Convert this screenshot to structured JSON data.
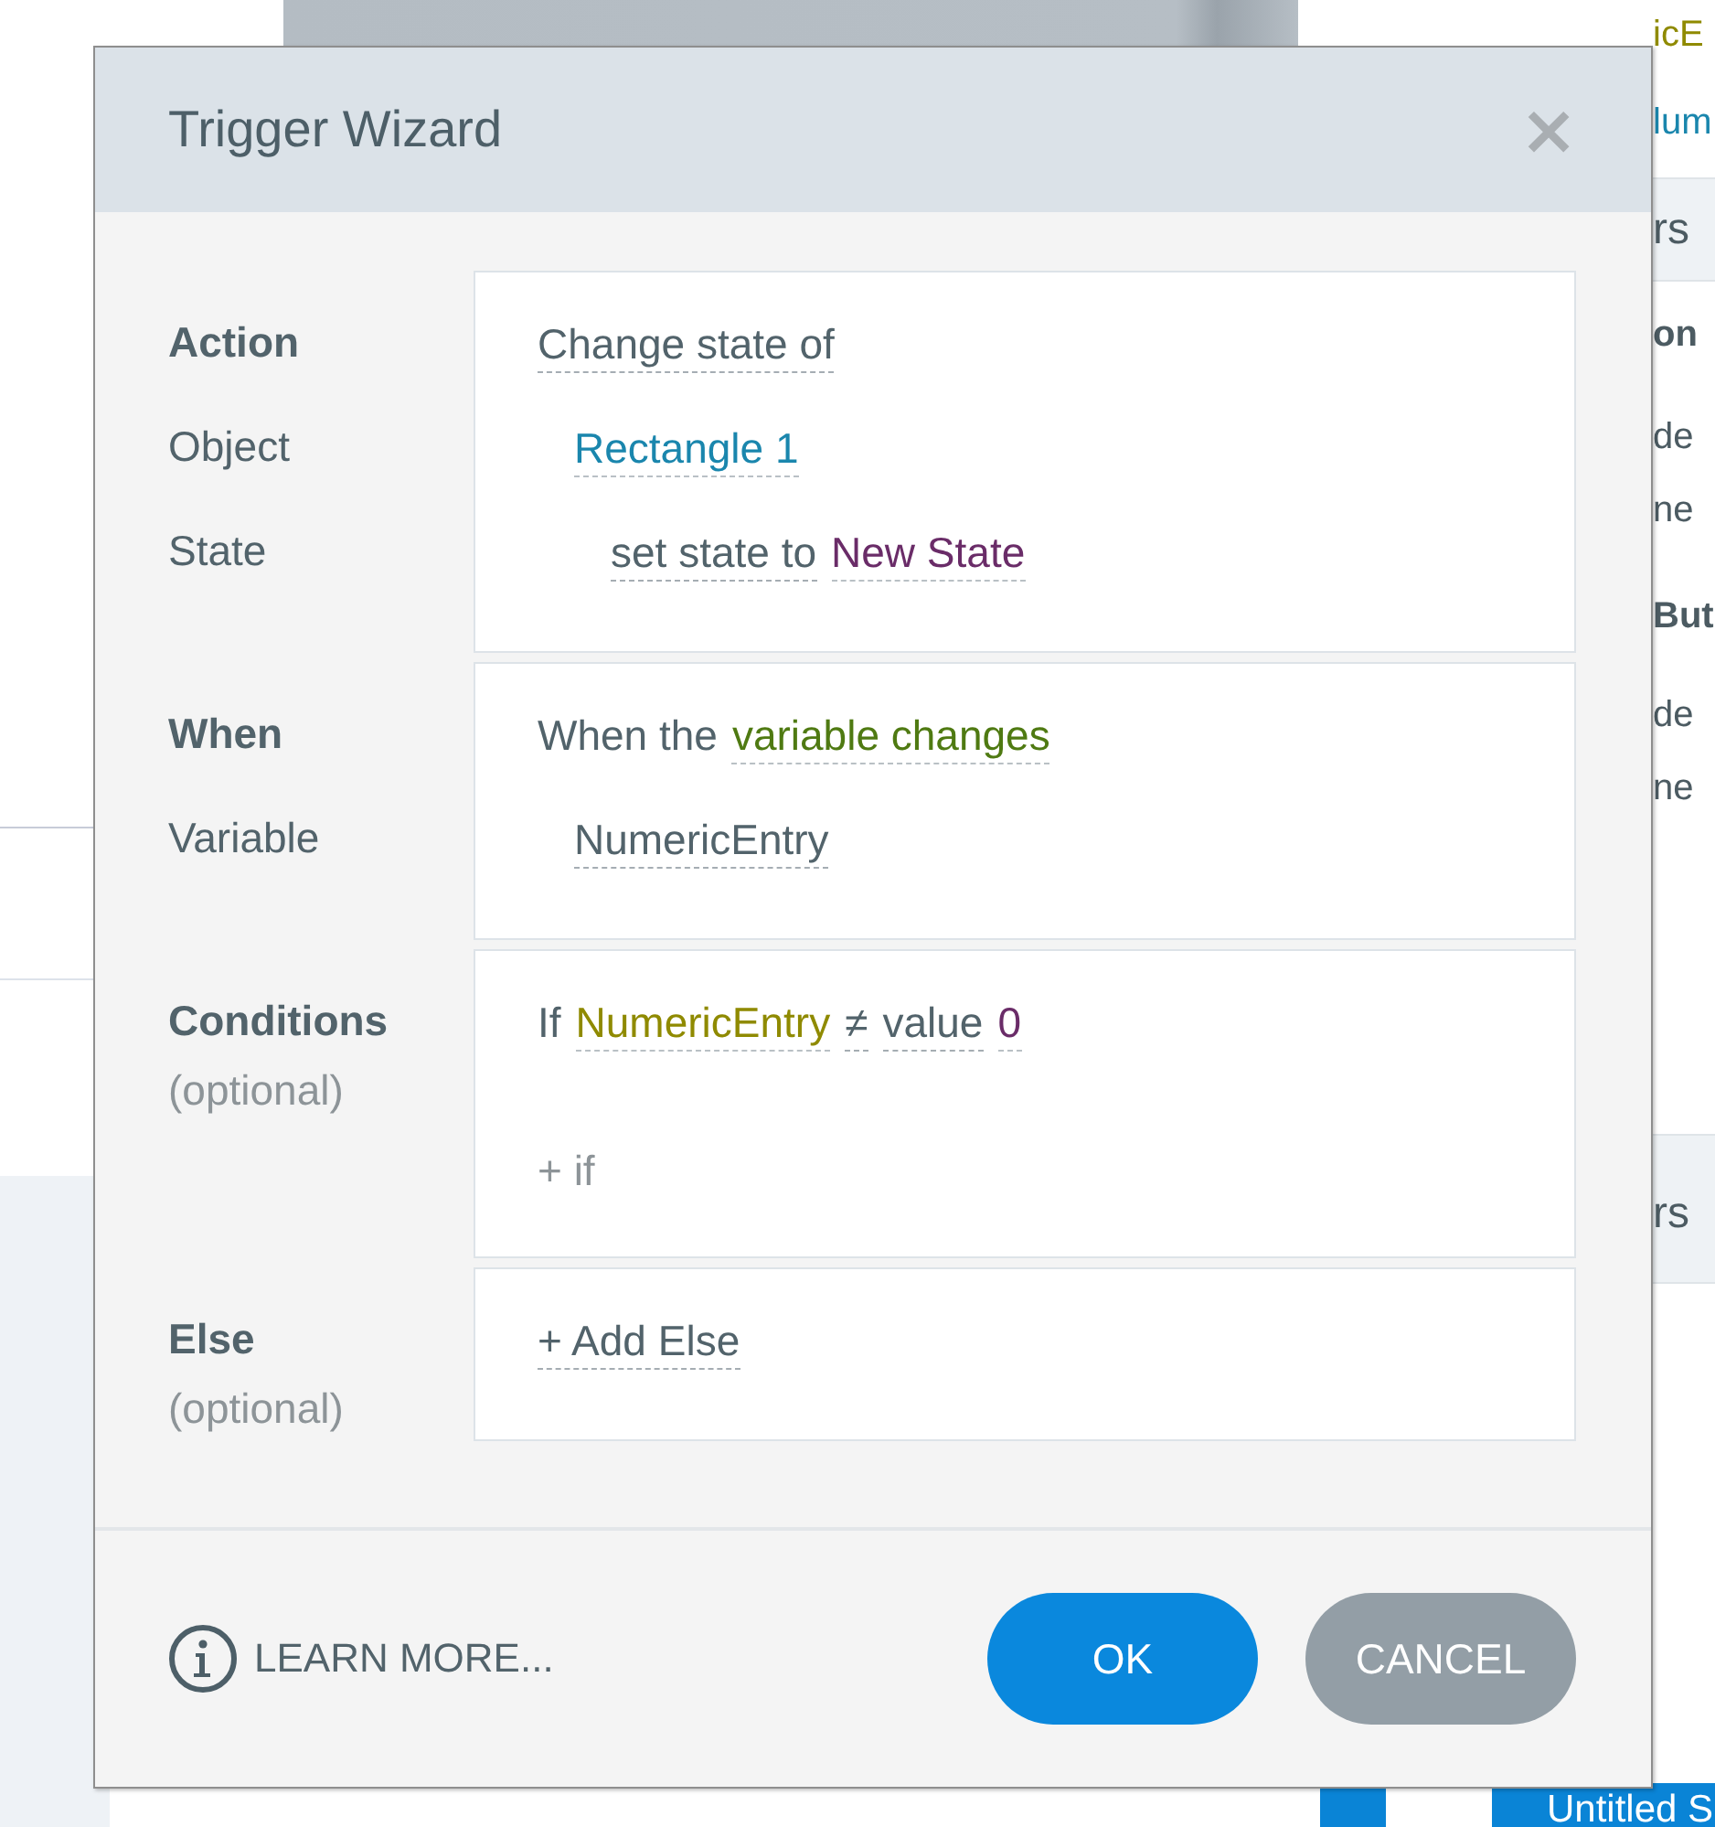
{
  "background": {
    "side_items": [
      {
        "text": "icE",
        "kind": "value"
      },
      {
        "text": "lum",
        "kind": "link"
      },
      {
        "text": "rs",
        "kind": "header"
      },
      {
        "text": "on",
        "kind": "bold"
      },
      {
        "text": "de",
        "kind": "text"
      },
      {
        "text": "ne",
        "kind": "text"
      },
      {
        "text": "But",
        "kind": "bold"
      },
      {
        "text": "de",
        "kind": "text"
      },
      {
        "text": "ne",
        "kind": "text"
      },
      {
        "text": "rs",
        "kind": "header"
      }
    ],
    "tab": {
      "label": "Untitled S"
    }
  },
  "dialog": {
    "title": "Trigger Wizard",
    "close": "×",
    "sections": [
      {
        "labels": [
          {
            "text": "Action",
            "kind": "heading"
          },
          {
            "text": "Object",
            "kind": "field"
          },
          {
            "text": "State",
            "kind": "field"
          }
        ],
        "rows": [
          {
            "kind": "line",
            "tokens": [
              {
                "text": "Change state of",
                "kind": "field"
              }
            ],
            "children": [
              {
                "kind": "line",
                "tokens": [
                  {
                    "text": "Rectangle 1",
                    "kind": "value",
                    "color": "#1a86ad"
                  }
                ],
                "children": [
                  {
                    "kind": "line",
                    "tokens": [
                      {
                        "text": "set state to",
                        "kind": "field"
                      },
                      {
                        "text": "New State",
                        "kind": "value",
                        "color": "#6a2c68"
                      }
                    ]
                  }
                ]
              }
            ]
          }
        ]
      },
      {
        "labels": [
          {
            "text": "When",
            "kind": "heading"
          },
          {
            "text": "Variable",
            "kind": "field"
          }
        ],
        "rows": [
          {
            "kind": "line",
            "tokens": [
              {
                "text": "When the",
                "kind": "text"
              },
              {
                "text": "variable changes",
                "kind": "value",
                "color": "#4f7a12"
              }
            ],
            "children": [
              {
                "kind": "line",
                "tokens": [
                  {
                    "text": "NumericEntry",
                    "kind": "field"
                  }
                ]
              }
            ]
          }
        ]
      },
      {
        "labels": [
          {
            "text": "Conditions",
            "kind": "heading"
          },
          {
            "text": "(optional)",
            "kind": "note"
          }
        ],
        "rows": [
          {
            "kind": "line",
            "tokens": [
              {
                "text": "If",
                "kind": "text"
              },
              {
                "text": "NumericEntry",
                "kind": "value",
                "color": "#8f8a00"
              },
              {
                "text": "≠",
                "kind": "field"
              },
              {
                "text": "value",
                "kind": "field"
              },
              {
                "text": "0",
                "kind": "value",
                "color": "#6a2c68"
              }
            ]
          },
          {
            "kind": "add",
            "tokens": [
              {
                "text": "+ if",
                "kind": "text"
              }
            ]
          }
        ]
      },
      {
        "labels": [
          {
            "text": "Else",
            "kind": "heading"
          },
          {
            "text": "(optional)",
            "kind": "note"
          }
        ],
        "rows": [
          {
            "kind": "line",
            "tokens": [
              {
                "text": "+ Add Else",
                "kind": "field"
              }
            ]
          }
        ]
      }
    ],
    "learn_more": "LEARN MORE...",
    "buttons": [
      {
        "label": "OK",
        "kind": "primary"
      },
      {
        "label": "CANCEL",
        "kind": "secondary"
      }
    ]
  }
}
